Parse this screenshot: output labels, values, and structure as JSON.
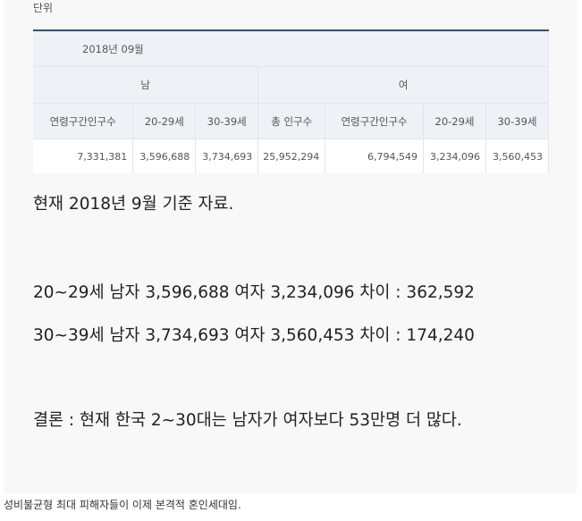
{
  "table": {
    "top_label": "단위",
    "period": "2018년 09월",
    "sex_labels": [
      "남",
      "여"
    ],
    "columns": [
      "연령구간인구수",
      "20-29세",
      "30-39세",
      "총 인구수",
      "연령구간인구수",
      "20-29세",
      "30-39세"
    ],
    "values": [
      "7,331,381",
      "3,596,688",
      "3,734,693",
      "25,952,294",
      "6,794,549",
      "3,234,096",
      "3,560,453"
    ]
  },
  "body": {
    "line1": "현재 2018년 9월 기준 자료.",
    "line2": "20~29세 남자 3,596,688 여자 3,234,096 차이 : 362,592",
    "line3": "30~39세 남자 3,734,693 여자 3,560,453 차이 : 174,240",
    "line4": "결론 : 현재 한국 2~30대는 남자가 여자보다 53만명 더 많다."
  },
  "caption": "성비불균형 최대 피해자들이 이제 본격적 혼인세대임."
}
